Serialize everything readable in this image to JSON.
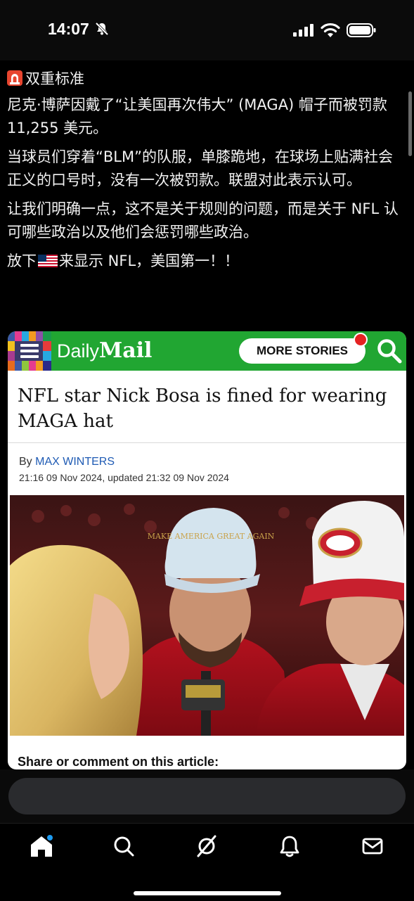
{
  "status_bar": {
    "time": "14:07"
  },
  "post": {
    "headline": "双重标准",
    "paragraphs": [
      "尼克·博萨因戴了“让美国再次伟大” (MAGA) 帽子而被罚款 11,255 美元。",
      "当球员们穿着“BLM”的队服，单膝跪地，在球场上贴满社会正义的口号时，没有一次被罚款。联盟对此表示认可。",
      "让我们明确一点，这不是关于规则的问题，而是关于 NFL 认可哪些政治以及他们会惩罚哪些政治。"
    ],
    "closing_before_flag": "放下",
    "closing_after_flag": "来显示 NFL，美国第一！！"
  },
  "article": {
    "logo_daily": "Daily",
    "logo_mail": "Mail",
    "more_stories": "MORE STORIES",
    "title": "NFL star Nick Bosa is fined for wearing MAGA hat",
    "by_prefix": "By ",
    "author": "MAX WINTERS",
    "dateline": "21:16 09 Nov 2024, updated 21:32 09 Nov 2024",
    "hat_text": "MAKE AMERICA GREAT AGAIN",
    "share_label": "Share or comment on this article:"
  },
  "colors": {
    "daily_mail_green": "#21a632",
    "notification_red": "#e52222",
    "author_link": "#1f5bb4",
    "reply_field": "#2a2b2e"
  },
  "icons": {
    "status": [
      "bell-muted-icon",
      "signal-icon",
      "wifi-icon",
      "battery-icon"
    ],
    "post": [
      "siren-icon",
      "us-flag-icon"
    ],
    "nav": [
      "home-icon",
      "search-icon",
      "grok-icon",
      "notifications-icon",
      "messages-icon"
    ]
  }
}
